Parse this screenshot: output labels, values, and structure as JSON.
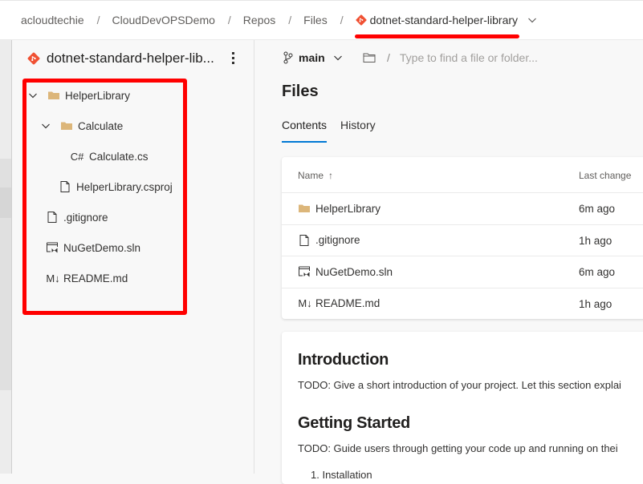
{
  "breadcrumb": {
    "items": [
      "acloudtechie",
      "CloudDevOPSDemo",
      "Repos",
      "Files"
    ],
    "repo": "dotnet-standard-helper-library",
    "separator": "/"
  },
  "colors": {
    "git_brand": "#f05133",
    "folder": "#dcb67a",
    "accent": "#0078d4",
    "annotation_red": "#ff0000"
  },
  "sidebar": {
    "repo_title": "dotnet-standard-helper-lib...",
    "more_icon": "more-vertical-icon",
    "tree": [
      {
        "label": "HelperLibrary",
        "type": "folder",
        "icon": "folder-icon",
        "expanded": true,
        "level": 0
      },
      {
        "label": "Calculate",
        "type": "folder",
        "icon": "folder-icon",
        "expanded": true,
        "level": 1
      },
      {
        "label": "Calculate.cs",
        "type": "file",
        "icon": "csharp-icon",
        "icon_text": "C#",
        "level": 2
      },
      {
        "label": "HelperLibrary.csproj",
        "type": "file",
        "icon": "file-icon",
        "level": 1
      },
      {
        "label": ".gitignore",
        "type": "file",
        "icon": "file-icon",
        "level": 0
      },
      {
        "label": "NuGetDemo.sln",
        "type": "file",
        "icon": "solution-icon",
        "level": 0
      },
      {
        "label": "README.md",
        "type": "file",
        "icon": "markdown-icon",
        "icon_text": "M↓",
        "level": 0
      }
    ]
  },
  "main": {
    "branch": "main",
    "path_separator": "/",
    "search_placeholder": "Type to find a file or folder...",
    "title": "Files",
    "tabs": [
      {
        "label": "Contents",
        "active": true
      },
      {
        "label": "History",
        "active": false
      }
    ],
    "table": {
      "columns": [
        "Name",
        "Last change"
      ],
      "sort_indicator": "↑",
      "rows": [
        {
          "name": "HelperLibrary",
          "icon": "folder-icon",
          "last_change": "6m ago"
        },
        {
          "name": ".gitignore",
          "icon": "file-icon",
          "last_change": "1h ago"
        },
        {
          "name": "NuGetDemo.sln",
          "icon": "solution-icon",
          "last_change": "6m ago"
        },
        {
          "name": "README.md",
          "icon": "markdown-icon",
          "icon_text": "M↓",
          "last_change": "1h ago"
        }
      ]
    },
    "readme": {
      "h1": "Introduction",
      "p1": "TODO: Give a short introduction of your project. Let this section explai",
      "h2": "Getting Started",
      "p2": "TODO: Guide users through getting your code up and running on thei",
      "list_item_1": "1.  Installation"
    }
  }
}
